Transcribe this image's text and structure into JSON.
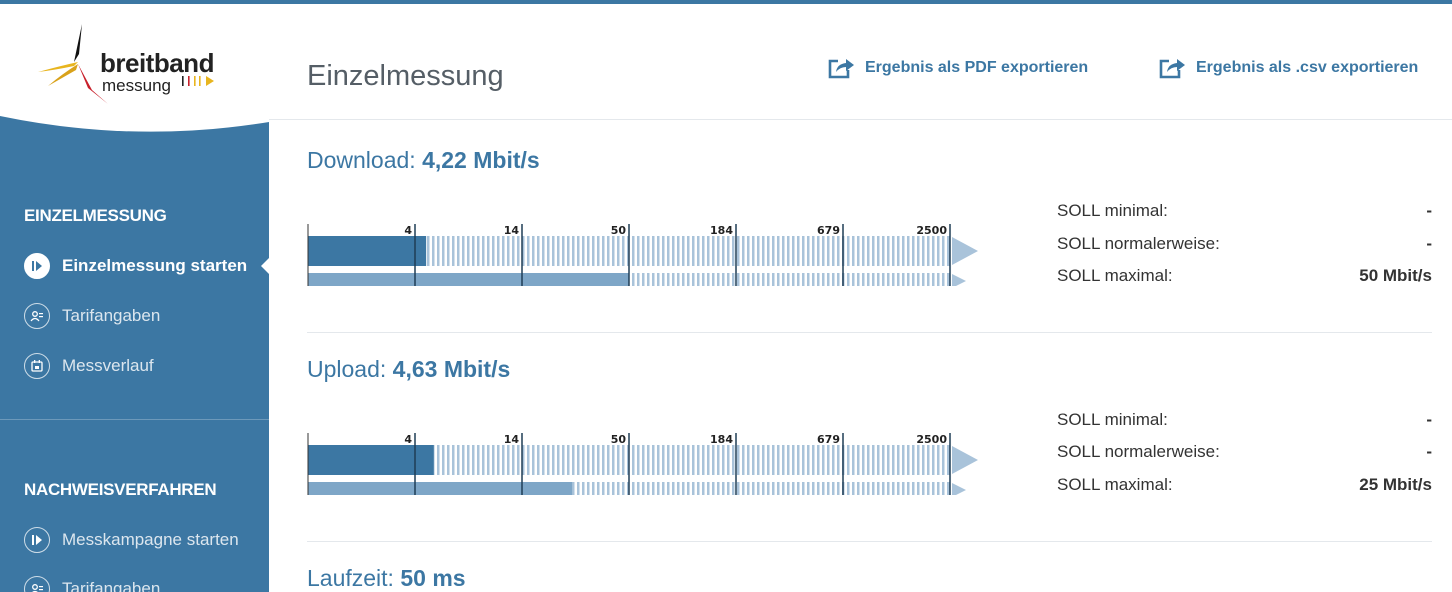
{
  "sidebar": {
    "logo": {
      "word1": "breitband",
      "word2": "messung"
    },
    "section1": {
      "heading": "EINZELMESSUNG",
      "items": [
        {
          "label": "Einzelmessung starten",
          "icon": "play-icon"
        },
        {
          "label": "Tarifangaben",
          "icon": "user-info-icon"
        },
        {
          "label": "Messverlauf",
          "icon": "calendar-icon"
        }
      ]
    },
    "section2": {
      "heading": "NACHWEISVERFAHREN",
      "items": [
        {
          "label": "Messkampagne starten",
          "icon": "play-icon"
        },
        {
          "label": "Tarifangaben",
          "icon": "user-info-icon"
        }
      ]
    }
  },
  "header": {
    "title": "Einzelmessung",
    "export_pdf": "Ergebnis als PDF exportieren",
    "export_csv": "Ergebnis als .csv exportieren"
  },
  "download": {
    "label": "Download:",
    "value": "4,22 Mbit/s",
    "soll": [
      {
        "label": "SOLL minimal:",
        "value": "-"
      },
      {
        "label": "SOLL normalerweise:",
        "value": "-"
      },
      {
        "label": "SOLL maximal:",
        "value": "50 Mbit/s"
      }
    ]
  },
  "upload": {
    "label": "Upload:",
    "value": "4,63 Mbit/s",
    "soll": [
      {
        "label": "SOLL minimal:",
        "value": "-"
      },
      {
        "label": "SOLL normalerweise:",
        "value": "-"
      },
      {
        "label": "SOLL maximal:",
        "value": "25 Mbit/s"
      }
    ]
  },
  "latency": {
    "label": "Laufzeit:",
    "value": "50 ms"
  },
  "chart_data": [
    {
      "type": "bar",
      "title": "Download",
      "scale": "log",
      "ticks": [
        "4",
        "14",
        "50",
        "184",
        "679",
        "2500"
      ],
      "measured_mbit": 4.22,
      "soll_max_mbit": 50
    },
    {
      "type": "bar",
      "title": "Upload",
      "scale": "log",
      "ticks": [
        "4",
        "14",
        "50",
        "184",
        "679",
        "2500"
      ],
      "measured_mbit": 4.63,
      "soll_max_mbit": 25
    }
  ],
  "colors": {
    "primary": "#3c77a3",
    "bar_light": "#7ea6c7",
    "hatch": "#a9c3da"
  }
}
